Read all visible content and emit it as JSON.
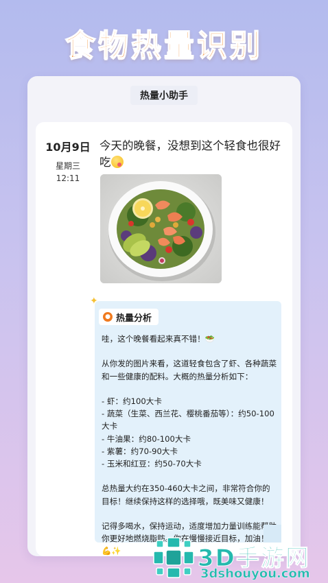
{
  "hero": {
    "title": "食物热量识别"
  },
  "card": {
    "header_title": "热量小助手"
  },
  "post": {
    "date": "10月9日",
    "weekday": "星期三",
    "time": "12:11",
    "message": "今天的晚餐，没想到这个轻食也很好吃"
  },
  "analysis": {
    "title": "热量分析",
    "body": "哇，这个晚餐看起来真不错！🥗\n\n从你发的图片来看，这道轻食包含了虾、各种蔬菜和一些健康的配料。大概的热量分析如下：\n\n- 虾：约100大卡\n- 蔬菜（生菜、西兰花、樱桃番茄等）：约50-100大卡\n- 牛油果：约80-100大卡\n- 紫薯：约70-90大卡\n- 玉米和红豆：约50-70大卡\n\n总热量大约在350-460大卡之间，非常符合你的目标！继续保持这样的选择哦，既美味又健康！\n\n记得多喝水，保持运动，适度增加力量训练能帮助你更好地燃烧脂肪。你在慢慢接近目标，加油！💪✨"
  },
  "watermark": {
    "brand": "3D手游网",
    "url": "3dshouyou.com"
  },
  "colors": {
    "accent": "#f08a2a",
    "watermark": "#25b9ae",
    "analysis_bg": "#e3f1fb"
  }
}
